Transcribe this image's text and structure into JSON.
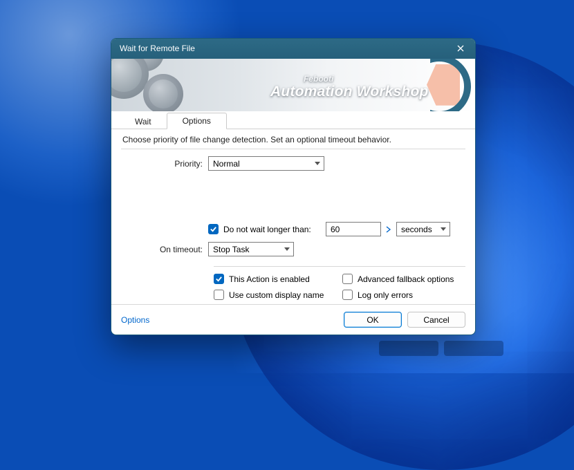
{
  "window": {
    "title": "Wait for Remote File"
  },
  "banner": {
    "brand": "Febooti",
    "product": "Automation Workshop"
  },
  "tabs": {
    "wait": "Wait",
    "options": "Options"
  },
  "description": "Choose priority of file change detection. Set an optional timeout behavior.",
  "priority": {
    "label": "Priority:",
    "value": "Normal"
  },
  "timeout": {
    "checkbox_label": "Do not wait longer than:",
    "value": "60",
    "unit": "seconds",
    "on_timeout_label": "On timeout:",
    "on_timeout_value": "Stop Task"
  },
  "options": {
    "enabled": "This Action is enabled",
    "advanced": "Advanced fallback options",
    "custom_name": "Use custom display name",
    "log_errors": "Log only errors"
  },
  "footer": {
    "options_link": "Options",
    "ok": "OK",
    "cancel": "Cancel"
  }
}
